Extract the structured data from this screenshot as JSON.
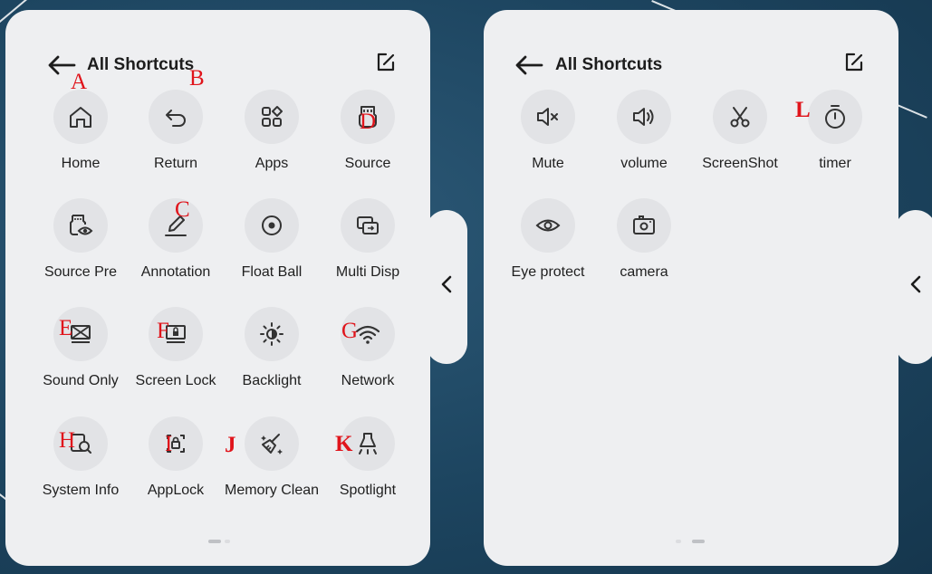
{
  "left_panel": {
    "title": "All Shortcuts",
    "items": [
      {
        "label": "Home",
        "icon": "home-icon"
      },
      {
        "label": "Return",
        "icon": "return-icon"
      },
      {
        "label": "Apps",
        "icon": "apps-icon"
      },
      {
        "label": "Source",
        "icon": "source-icon"
      },
      {
        "label": "Source Pre",
        "icon": "source-preview-icon"
      },
      {
        "label": "Annotation",
        "icon": "annotation-icon"
      },
      {
        "label": "Float Ball",
        "icon": "float-ball-icon"
      },
      {
        "label": "Multi Disp",
        "icon": "multi-display-icon"
      },
      {
        "label": "Sound Only",
        "icon": "sound-only-icon"
      },
      {
        "label": "Screen Lock",
        "icon": "screen-lock-icon"
      },
      {
        "label": "Backlight",
        "icon": "backlight-icon"
      },
      {
        "label": "Network",
        "icon": "network-icon"
      },
      {
        "label": "System Info",
        "icon": "system-info-icon"
      },
      {
        "label": "AppLock",
        "icon": "app-lock-icon"
      },
      {
        "label": "Memory Clean",
        "icon": "memory-clean-icon"
      },
      {
        "label": "Spotlight",
        "icon": "spotlight-icon"
      }
    ]
  },
  "right_panel": {
    "title": "All Shortcuts",
    "items": [
      {
        "label": "Mute",
        "icon": "mute-icon"
      },
      {
        "label": "volume",
        "icon": "volume-icon"
      },
      {
        "label": "ScreenShot",
        "icon": "screenshot-icon"
      },
      {
        "label": "timer",
        "icon": "timer-icon"
      },
      {
        "label": "Eye protect",
        "icon": "eye-protect-icon"
      },
      {
        "label": "camera",
        "icon": "camera-icon"
      }
    ]
  },
  "annotations": {
    "A": "A",
    "B": "B",
    "C": "C",
    "D": "D",
    "E": "E",
    "F": "F",
    "G": "G",
    "H": "H",
    "I": "I",
    "J": "J",
    "K": "K",
    "L": "L"
  },
  "colors": {
    "background": "#1d4560",
    "panel": "#eeeff1",
    "icon_circle": "#e2e3e6",
    "annotation_marker": "#e0141b"
  }
}
